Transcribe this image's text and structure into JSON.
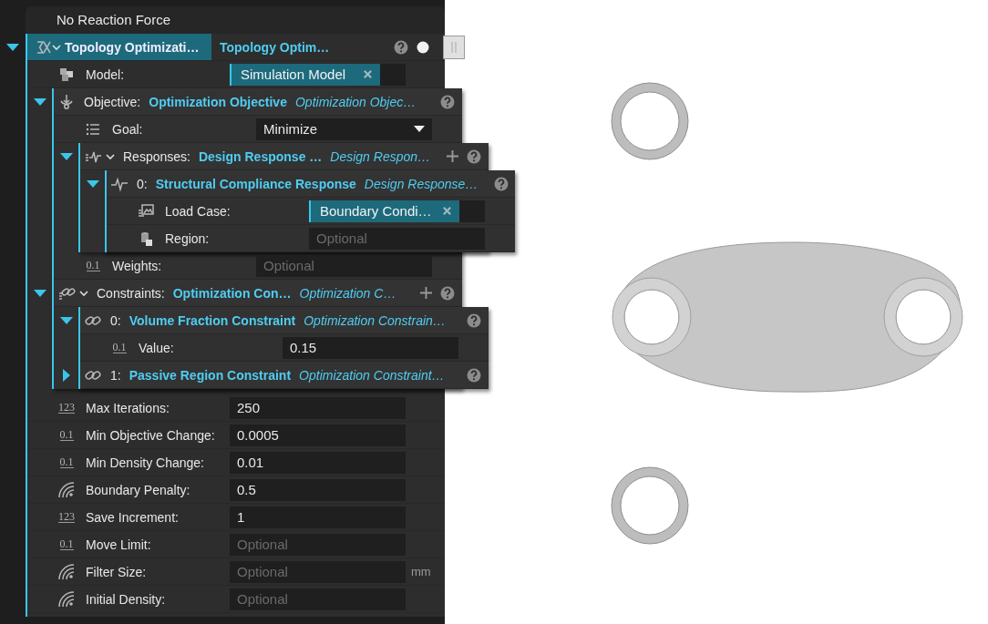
{
  "header": "No Reaction Force",
  "root": {
    "title": "Topology Optimizati…",
    "type": "Topology Optim…",
    "expanded": true,
    "selected": true
  },
  "model": {
    "kind": "chip",
    "label": "Model:",
    "value": "Simulation Model"
  },
  "objective": {
    "label": "Objective:",
    "value": "Optimization Objective",
    "type": "Optimization Objec…",
    "expanded": true,
    "goal": {
      "kind": "dropdown",
      "label": "Goal:",
      "value": "Minimize"
    },
    "responses": {
      "label": "Responses:",
      "value": "Design Response …",
      "type": "Design Respon…",
      "expanded": true,
      "items": [
        {
          "index": "0:",
          "name": "Structural Compliance Response",
          "type": "Design Response…",
          "expanded": true,
          "fields": [
            {
              "kind": "chip",
              "label": "Load Case:",
              "value": "Boundary Condi…"
            },
            {
              "kind": "text",
              "label": "Region:",
              "placeholder": "Optional"
            }
          ]
        }
      ]
    },
    "weights": {
      "kind": "text",
      "glyph": "0.1",
      "label": "Weights:",
      "placeholder": "Optional"
    }
  },
  "constraints": {
    "label": "Constraints:",
    "value": "Optimization Con…",
    "type": "Optimization C…",
    "expanded": true,
    "items": [
      {
        "index": "0:",
        "name": "Volume Fraction Constraint",
        "type": "Optimization Constrain…",
        "expanded": true,
        "fields": [
          {
            "kind": "text",
            "glyph": "0.1",
            "label": "Value:",
            "value": "0.15"
          }
        ]
      },
      {
        "index": "1:",
        "name": "Passive Region Constraint",
        "type": "Optimization Constraint…",
        "expanded": false
      }
    ]
  },
  "settings": [
    {
      "kind": "text",
      "glyph": "123",
      "label": "Max Iterations:",
      "value": "250"
    },
    {
      "kind": "text",
      "glyph": "0.1",
      "label": "Min Objective Change:",
      "value": "0.0005"
    },
    {
      "kind": "text",
      "glyph": "0.1",
      "label": "Min Density Change:",
      "value": "0.01"
    },
    {
      "kind": "text",
      "label": "Boundary Penalty:",
      "value": "0.5"
    },
    {
      "kind": "text",
      "glyph": "123",
      "label": "Save Increment:",
      "value": "1"
    },
    {
      "kind": "text",
      "glyph": "0.1",
      "label": "Move Limit:",
      "placeholder": "Optional"
    },
    {
      "kind": "text",
      "label": "Filter Size:",
      "placeholder": "Optional",
      "unit": "mm"
    },
    {
      "kind": "text",
      "label": "Initial Density:",
      "placeholder": "Optional"
    }
  ]
}
